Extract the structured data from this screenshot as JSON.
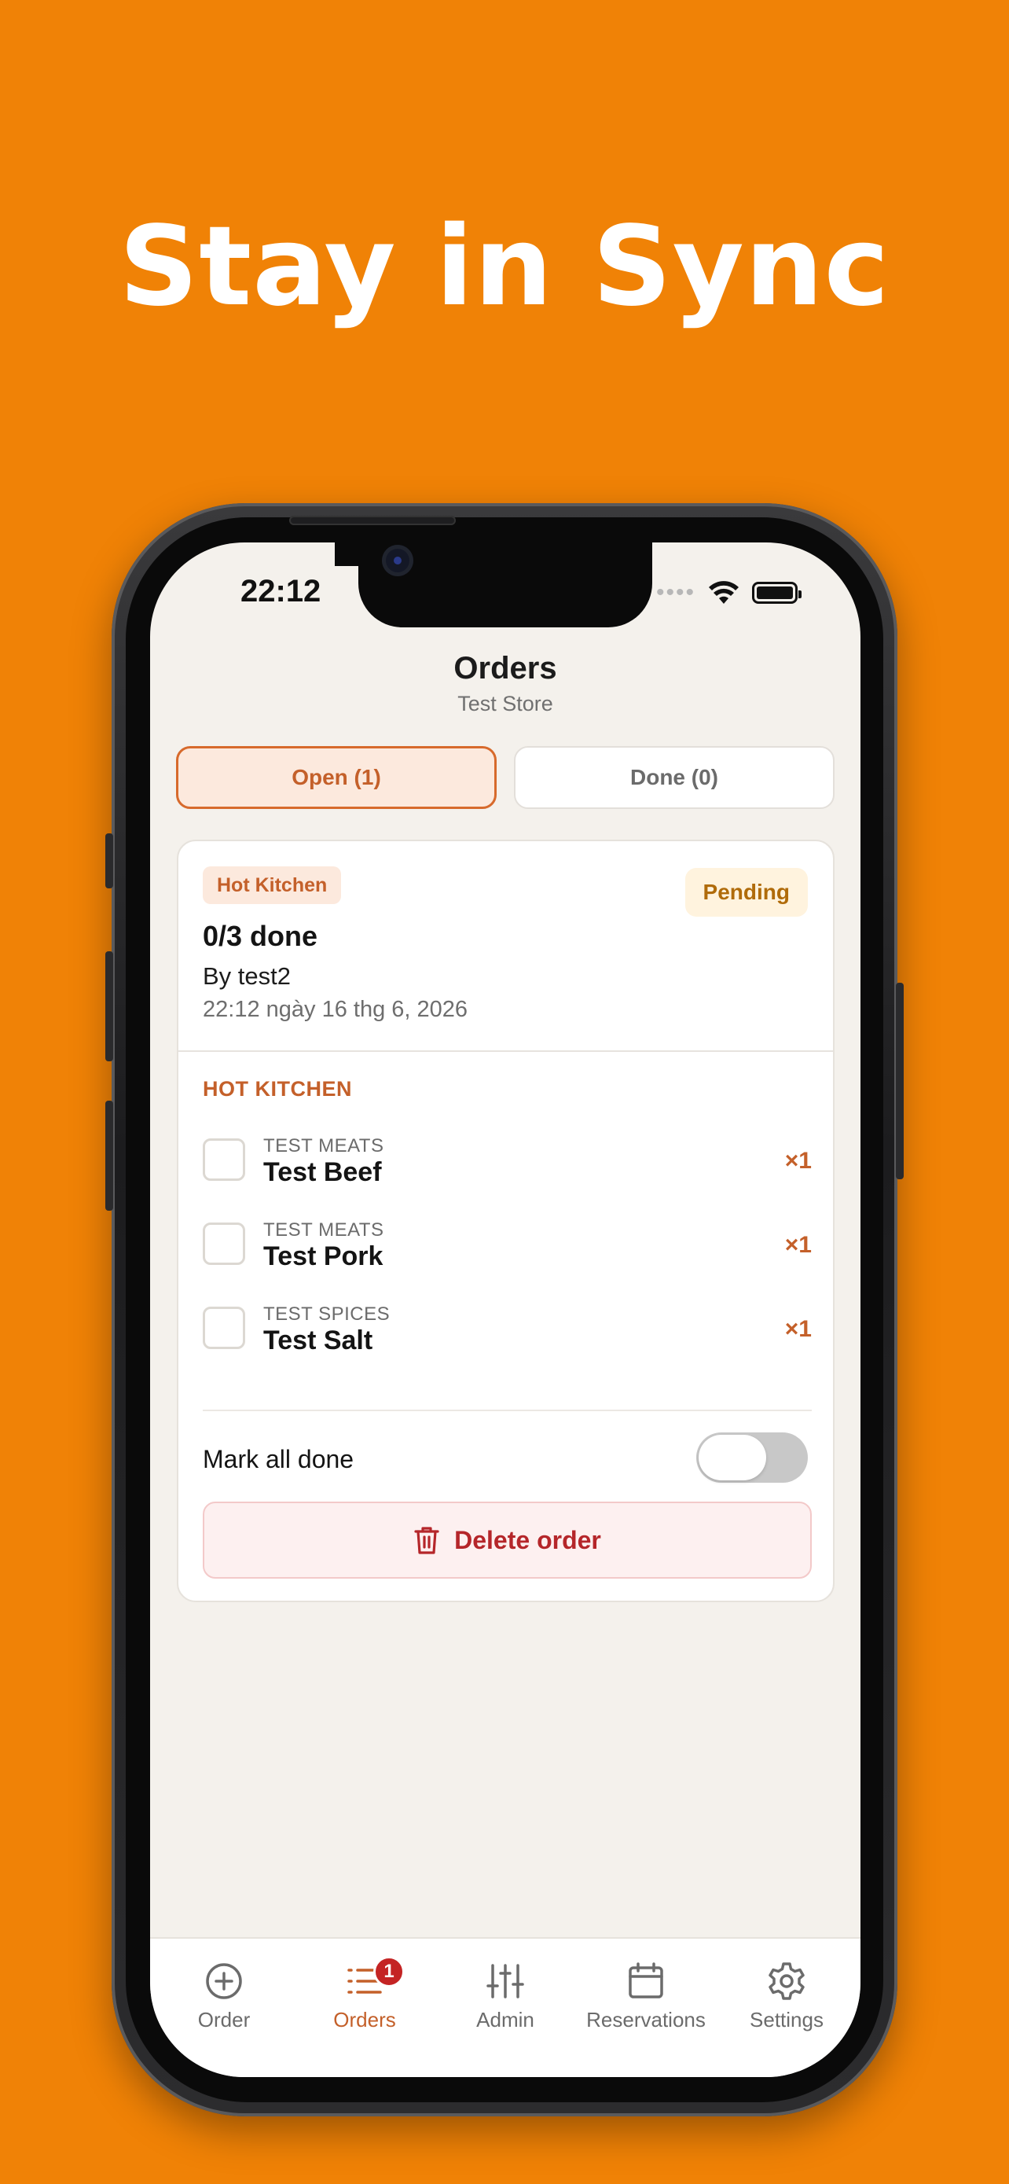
{
  "headline": "Stay in Sync",
  "status_bar": {
    "time": "22:12"
  },
  "nav": {
    "title": "Orders",
    "subtitle": "Test Store"
  },
  "segments": {
    "open_label": "Open (1)",
    "done_label": "Done (0)",
    "selected": "open"
  },
  "order": {
    "station_chip": "Hot Kitchen",
    "status": "Pending",
    "progress": "0/3 done",
    "by": "By test2",
    "date": "22:12 ngày 16 thg 6, 2026",
    "section_heading": "HOT KITCHEN",
    "items": [
      {
        "category": "TEST MEATS",
        "name": "Test Beef",
        "qty": "×1",
        "checked": false
      },
      {
        "category": "TEST MEATS",
        "name": "Test Pork",
        "qty": "×1",
        "checked": false
      },
      {
        "category": "TEST SPICES",
        "name": "Test Salt",
        "qty": "×1",
        "checked": false
      }
    ],
    "mark_all_label": "Mark all done",
    "mark_all_on": false,
    "delete_label": "Delete order"
  },
  "tabbar": {
    "tabs": [
      {
        "label": "Order",
        "icon": "plus-circle-icon"
      },
      {
        "label": "Orders",
        "icon": "list-icon",
        "badge": "1",
        "active": true
      },
      {
        "label": "Admin",
        "icon": "sliders-icon"
      },
      {
        "label": "Reservations",
        "icon": "calendar-icon"
      },
      {
        "label": "Settings",
        "icon": "gear-icon"
      }
    ]
  },
  "colors": {
    "background": "#F08206",
    "accent": "#C4602A",
    "pending": "#B06B0A",
    "danger": "#B5262A"
  }
}
